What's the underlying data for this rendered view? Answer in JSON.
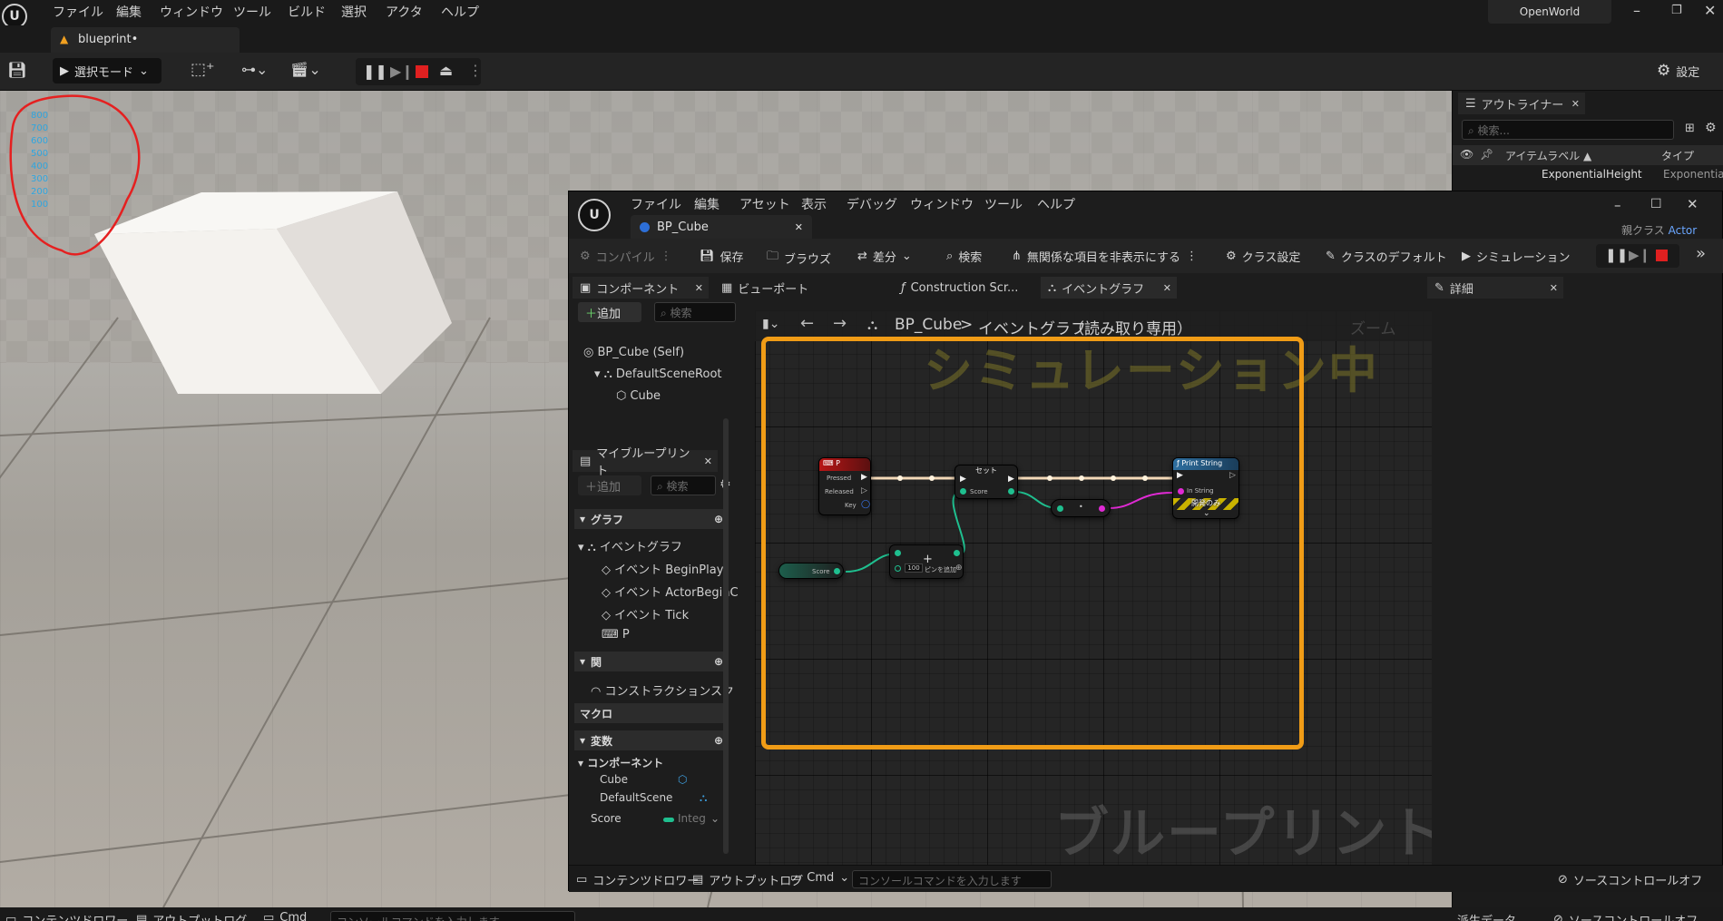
{
  "menubar": {
    "items": [
      "ファイル",
      "編集",
      "ウィンドウ",
      "ツール",
      "ビルド",
      "選択",
      "アクタ",
      "ヘルプ"
    ],
    "project": "OpenWorld"
  },
  "doc_tab": {
    "label": "blueprint•"
  },
  "toolbar": {
    "select_mode": "選択モード",
    "settings": "設定"
  },
  "viewport": {
    "y_labels": [
      "800",
      "700",
      "600",
      "500",
      "400",
      "300",
      "200",
      "100"
    ]
  },
  "outliner": {
    "title": "アウトライナー",
    "search_placeholder": "検索...",
    "col_label": "アイテムラベル ▲",
    "col_type": "タイプ",
    "row_label": "ExponentialHeight",
    "row_type": "Exponentia"
  },
  "bp": {
    "menu": [
      "ファイル",
      "編集",
      "アセット",
      "表示",
      "デバッグ",
      "ウィンドウ",
      "ツール",
      "ヘルプ"
    ],
    "tab": "BP_Cube",
    "parent_class_label": "親クラス",
    "parent_class": "Actor",
    "toolbar": {
      "compile": "コンパイル",
      "save": "保存",
      "browse": "ブラウズ",
      "diff": "差分",
      "search": "検索",
      "hide": "無関係な項目を非表示にする",
      "class_settings": "クラス設定",
      "class_defaults": "クラスのデフォルト",
      "simulation": "シミュレーション"
    },
    "components": {
      "title": "コンポーネント",
      "add": "追加",
      "search_placeholder": "検索",
      "tree": [
        "BP_Cube (Self)",
        "DefaultSceneRoot",
        "Cube"
      ]
    },
    "mybp": {
      "title": "マイブループリント",
      "add": "追加",
      "search_placeholder": "検索",
      "graph_hdr": "グラフ",
      "event_graph": "イベントグラフ",
      "events": [
        "イベント BeginPlay",
        "イベント ActorBeginC",
        "イベント Tick",
        "P"
      ],
      "func_hdr": "関",
      "construction": "コンストラクションスク",
      "macro_hdr": "マクロ",
      "var_hdr": "変数",
      "comp_hdr": "コンポーネント",
      "vars": [
        "Cube",
        "DefaultScene"
      ],
      "score": "Score",
      "score_type": "Integ"
    },
    "tabs": {
      "viewport": "ビューポート",
      "construction": "Construction Scr...",
      "event_graph": "イベントグラフ",
      "details": "詳細"
    },
    "graph": {
      "breadcrumb_bp": "BP_Cube",
      "breadcrumb_graph": "イベントグラフ",
      "readonly": "（読み取り専用）",
      "zoom": "ズーム",
      "sim_watermark": "シミュレーション中",
      "bp_watermark": "ブループリント",
      "node_p": "P",
      "pressed": "Pressed",
      "released": "Released",
      "key": "Key",
      "set": "セット",
      "score": "Score",
      "print": "Print String",
      "in_string": "In String",
      "dev_only": "開発のみ",
      "get_score": "Score",
      "add_pin": "ピンを追加",
      "const_val": "100"
    },
    "bottom": {
      "content_drawer": "コンテンツドロワー",
      "output_log": "アウトプットログ",
      "cmd": "Cmd",
      "cmd_placeholder": "コンソールコマンドを入力します",
      "source_control": "ソースコントロールオフ"
    }
  },
  "main_bottom": {
    "content_drawer": "コンテンツドロワー",
    "output_log": "アウトプットログ",
    "cmd": "Cmd",
    "cmd_placeholder": "コンソールコマンドを入力します",
    "recent": "派生データ",
    "source_control": "ソースコントロールオフ"
  }
}
